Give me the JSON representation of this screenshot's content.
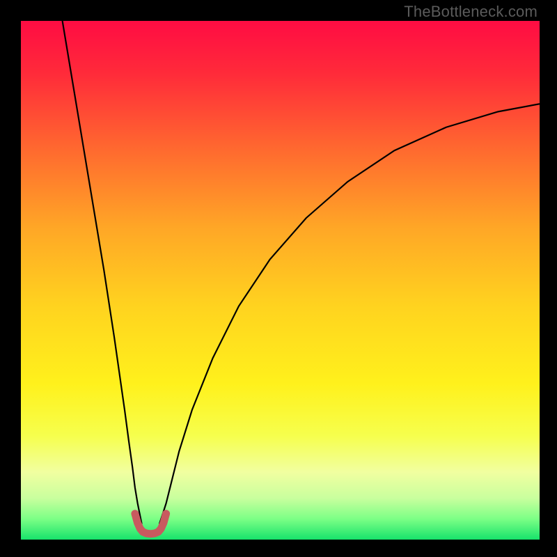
{
  "watermark": "TheBottleneck.com",
  "chart_data": {
    "type": "line",
    "title": "",
    "xlabel": "",
    "ylabel": "",
    "xlim": [
      0,
      100
    ],
    "ylim": [
      0,
      100
    ],
    "grid": false,
    "legend": false,
    "gradient_stops": [
      {
        "pos": 0.0,
        "color": "#ff0c43"
      },
      {
        "pos": 0.1,
        "color": "#ff2a3a"
      },
      {
        "pos": 0.25,
        "color": "#ff6a2f"
      },
      {
        "pos": 0.4,
        "color": "#ffa726"
      },
      {
        "pos": 0.55,
        "color": "#ffd31f"
      },
      {
        "pos": 0.7,
        "color": "#fff11c"
      },
      {
        "pos": 0.8,
        "color": "#f6ff4d"
      },
      {
        "pos": 0.87,
        "color": "#f1ffa0"
      },
      {
        "pos": 0.92,
        "color": "#c9ff9e"
      },
      {
        "pos": 0.96,
        "color": "#7cff86"
      },
      {
        "pos": 1.0,
        "color": "#17e36b"
      }
    ],
    "series": [
      {
        "name": "left-branch",
        "color": "#000000",
        "stroke_width": 2.2,
        "x": [
          8,
          10,
          12,
          14,
          16,
          18,
          19,
          20,
          20.8,
          21.5,
          22,
          22.5,
          23,
          23.3
        ],
        "y": [
          100,
          88,
          76,
          64,
          52,
          39,
          32,
          25,
          19,
          14,
          10,
          7,
          4.5,
          3
        ]
      },
      {
        "name": "right-branch",
        "color": "#000000",
        "stroke_width": 2.2,
        "x": [
          26.7,
          27.2,
          28,
          29,
          30.5,
          33,
          37,
          42,
          48,
          55,
          63,
          72,
          82,
          92,
          100
        ],
        "y": [
          3,
          4.5,
          7,
          11,
          17,
          25,
          35,
          45,
          54,
          62,
          69,
          75,
          79.5,
          82.5,
          84
        ]
      },
      {
        "name": "bottom-u-highlight",
        "color": "#c85a5f",
        "stroke_width": 11,
        "linecap": "round",
        "x": [
          22.0,
          22.5,
          23.0,
          23.5,
          24.2,
          25.0,
          25.8,
          26.5,
          27.0,
          27.5,
          28.0
        ],
        "y": [
          5.0,
          3.2,
          2.1,
          1.5,
          1.2,
          1.1,
          1.2,
          1.5,
          2.1,
          3.2,
          5.0
        ]
      }
    ]
  }
}
